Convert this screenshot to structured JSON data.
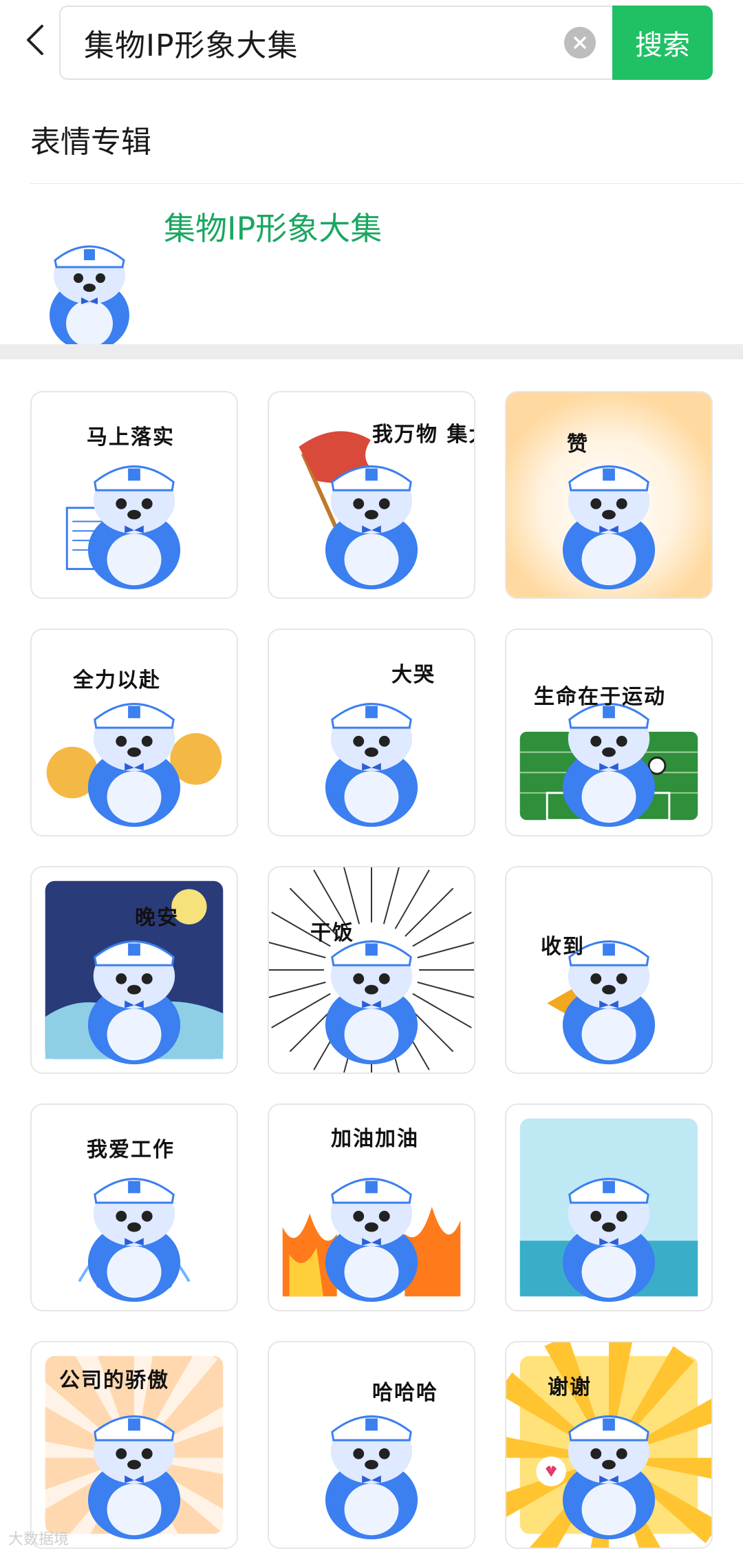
{
  "search": {
    "query": "集物IP形象大集",
    "button_label": "搜索"
  },
  "section": {
    "title": "表情专辑"
  },
  "album": {
    "name": "集物IP形象大集"
  },
  "stickers": [
    {
      "caption": "马上落实",
      "theme": "document"
    },
    {
      "caption": "我万物 集大成",
      "theme": "flag"
    },
    {
      "caption": "赞",
      "theme": "thumbs"
    },
    {
      "caption": "全力以赴",
      "theme": "pompom"
    },
    {
      "caption": "大哭",
      "theme": "cry"
    },
    {
      "caption": "生命在于运动",
      "theme": "soccer"
    },
    {
      "caption": "晚安",
      "theme": "night"
    },
    {
      "caption": "干饭",
      "theme": "noodles"
    },
    {
      "caption": "收到",
      "theme": "megaphone"
    },
    {
      "caption": "我爱工作",
      "theme": "laptop"
    },
    {
      "caption": "加油加油",
      "theme": "fire"
    },
    {
      "caption": "",
      "theme": "sea"
    },
    {
      "caption": "公司的骄傲",
      "theme": "proud"
    },
    {
      "caption": "哈哈哈",
      "theme": "laugh"
    },
    {
      "caption": "谢谢",
      "theme": "thanks"
    }
  ],
  "watermark": "大数据境",
  "colors": {
    "accent": "#20c065",
    "album_name": "#1aa760",
    "mascot_blue": "#3b7ff0"
  }
}
